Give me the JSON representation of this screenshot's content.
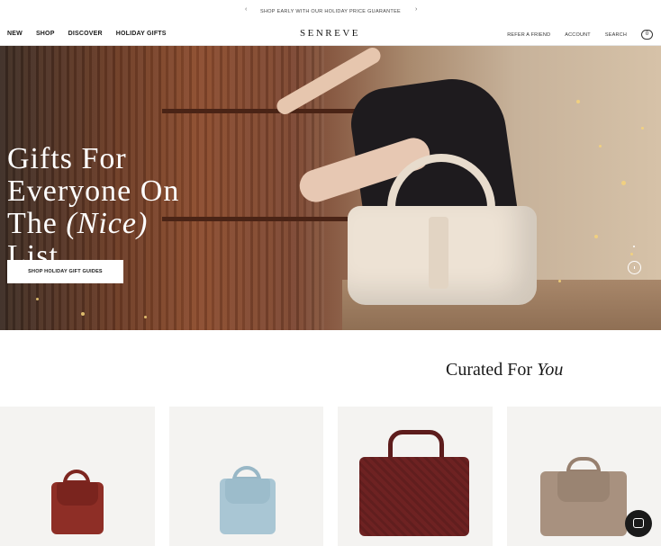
{
  "announcement": {
    "text": "SHOP EARLY WITH OUR HOLIDAY PRICE GUARANTEE",
    "prev_icon": "‹",
    "next_icon": "›"
  },
  "header": {
    "nav_left": [
      "NEW",
      "SHOP",
      "DISCOVER",
      "HOLIDAY GIFTS"
    ],
    "logo": "SENREVE",
    "nav_right": [
      "REFER A FRIEND",
      "ACCOUNT",
      "SEARCH"
    ],
    "cart_count": "0"
  },
  "hero": {
    "title_line1": "Gifts For",
    "title_line2": "Everyone On",
    "title_line3_pre": "The ",
    "title_line3_it": "(Nice)",
    "title_line4": "List",
    "cta": "SHOP HOLIDAY GIFT GUIDES"
  },
  "curated": {
    "prefix": "Curated For ",
    "italic": "You"
  },
  "products": [
    {
      "icon": "red-mini-bag",
      "color": "#8e2e26"
    },
    {
      "icon": "light-blue-mini-bag",
      "color": "#a9c6d4"
    },
    {
      "icon": "burgundy-croc-tote",
      "color": "#6e2222"
    },
    {
      "icon": "taupe-backpack",
      "color": "#a8917f"
    }
  ],
  "chat": {
    "icon": "chat-icon"
  }
}
